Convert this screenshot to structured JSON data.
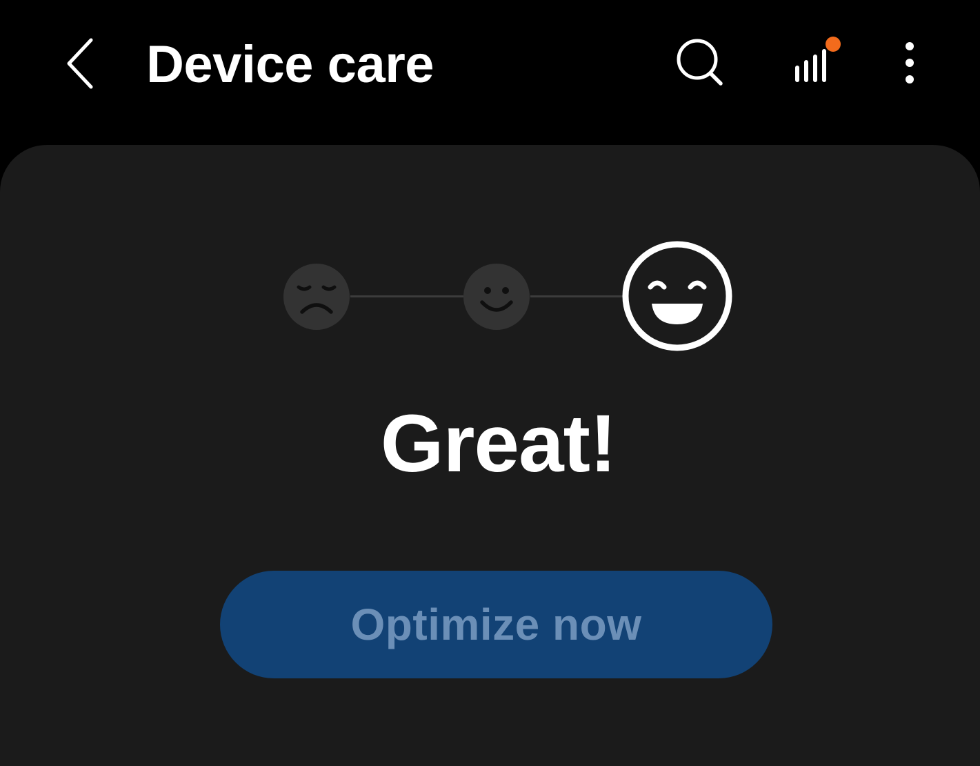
{
  "app_bar": {
    "title": "Device care",
    "back_icon": "chevron-left-icon",
    "search_icon": "search-icon",
    "stats_icon": "signal-bars-icon",
    "more_icon": "more-vertical-icon",
    "notification_dot_color": "#f36b1c"
  },
  "status": {
    "levels": [
      {
        "icon": "sad-face-icon",
        "active": false
      },
      {
        "icon": "smile-face-icon",
        "active": false
      },
      {
        "icon": "laughing-face-icon",
        "active": true
      }
    ],
    "label": "Great!"
  },
  "optimize_button": {
    "label": "Optimize now",
    "enabled": false
  },
  "colors": {
    "background": "#000000",
    "card": "#1b1b1b",
    "inactive_face": "#333333",
    "button_bg": "#124275",
    "button_text": "#6b8fb7",
    "accent_dot": "#f36b1c"
  }
}
